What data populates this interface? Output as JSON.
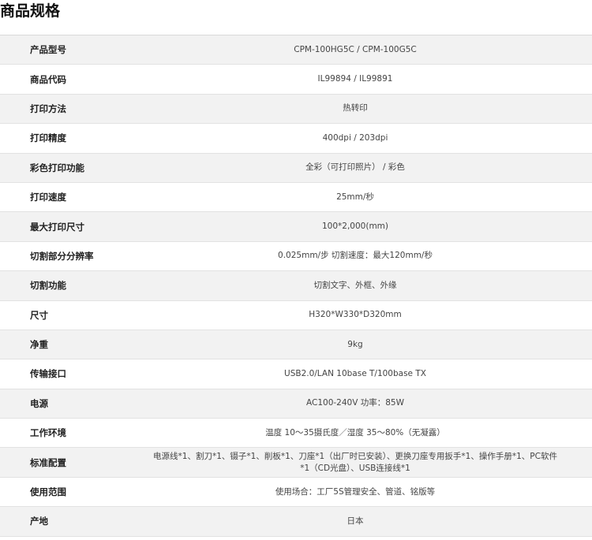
{
  "title": "商品规格",
  "specs": [
    {
      "label": "产品型号",
      "value": "CPM-100HG5C / CPM-100G5C"
    },
    {
      "label": "商品代码",
      "value": "IL99894 / IL99891"
    },
    {
      "label": "打印方法",
      "value": "热转印"
    },
    {
      "label": "打印精度",
      "value": "400dpi / 203dpi"
    },
    {
      "label": "彩色打印功能",
      "value": "全彩（可打印照片） / 彩色"
    },
    {
      "label": "打印速度",
      "value": "25mm/秒"
    },
    {
      "label": "最大打印尺寸",
      "value": "100*2,000(mm)"
    },
    {
      "label": "切割部分分辨率",
      "value": "0.025mm/步 切割速度：最大120mm/秒"
    },
    {
      "label": "切割功能",
      "value": "切割文字、外框、外缘"
    },
    {
      "label": "尺寸",
      "value": "H320*W330*D320mm"
    },
    {
      "label": "净重",
      "value": "9kg"
    },
    {
      "label": "传输接口",
      "value": "USB2.0/LAN 10base T/100base TX"
    },
    {
      "label": "电源",
      "value": "AC100-240V 功率：85W"
    },
    {
      "label": "工作环境",
      "value": "温度 10～35摄氏度／湿度 35～80%（无凝露）"
    },
    {
      "label": "标准配置",
      "value": "电源线*1、割刀*1、镊子*1、削板*1、刀座*1（出厂时已安装）、更换刀座专用扳手*1、操作手册*1、PC软件*1（CD光盘）、USB连接线*1"
    },
    {
      "label": "使用范围",
      "value": "使用场合：工厂5S管理安全、管道、铭版等"
    },
    {
      "label": "产地",
      "value": "日本"
    }
  ]
}
